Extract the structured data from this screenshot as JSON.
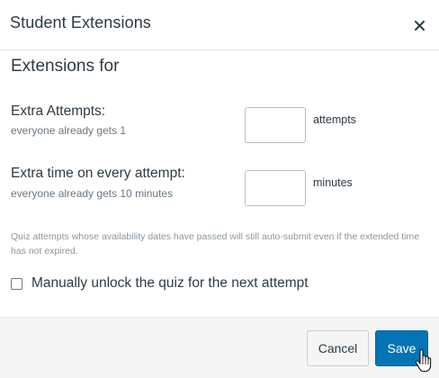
{
  "dialog": {
    "title": "Student Extensions",
    "close_icon": "close-icon"
  },
  "form": {
    "subtitle": "Extensions for",
    "extra_attempts": {
      "label": "Extra Attempts:",
      "hint": "everyone already gets 1",
      "value": "",
      "unit": "attempts"
    },
    "extra_time": {
      "label": "Extra time on every attempt:",
      "hint": "everyone already gets 10 minutes",
      "value": "",
      "unit": "minutes"
    },
    "note": "Quiz attempts whose availability dates have passed will still auto-submit even if the extended time has not expired.",
    "unlock": {
      "label": "Manually unlock the quiz for the next attempt",
      "checked": false
    }
  },
  "footer": {
    "cancel_label": "Cancel",
    "save_label": "Save"
  },
  "colors": {
    "primary": "#0374b5",
    "text": "#2d3b45",
    "muted": "#6b7780",
    "footer_bg": "#f5f5f5"
  }
}
